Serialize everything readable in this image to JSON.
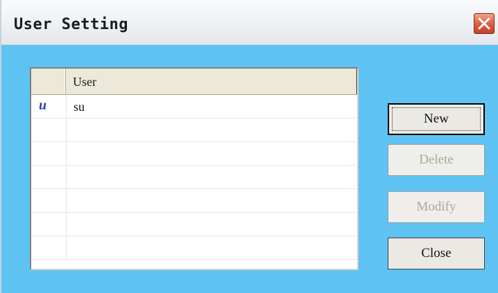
{
  "window": {
    "title": "User Setting"
  },
  "list": {
    "columns": [
      "",
      "User"
    ],
    "rows": [
      {
        "icon": "u",
        "user": "su"
      }
    ]
  },
  "buttons": {
    "new_label": "New",
    "delete_label": "Delete",
    "modify_label": "Modify",
    "close_label": "Close"
  },
  "colors": {
    "dialog_background": "#5ec3f3",
    "close_button": "#dc5b3d",
    "user_icon": "#2b3fb0"
  }
}
